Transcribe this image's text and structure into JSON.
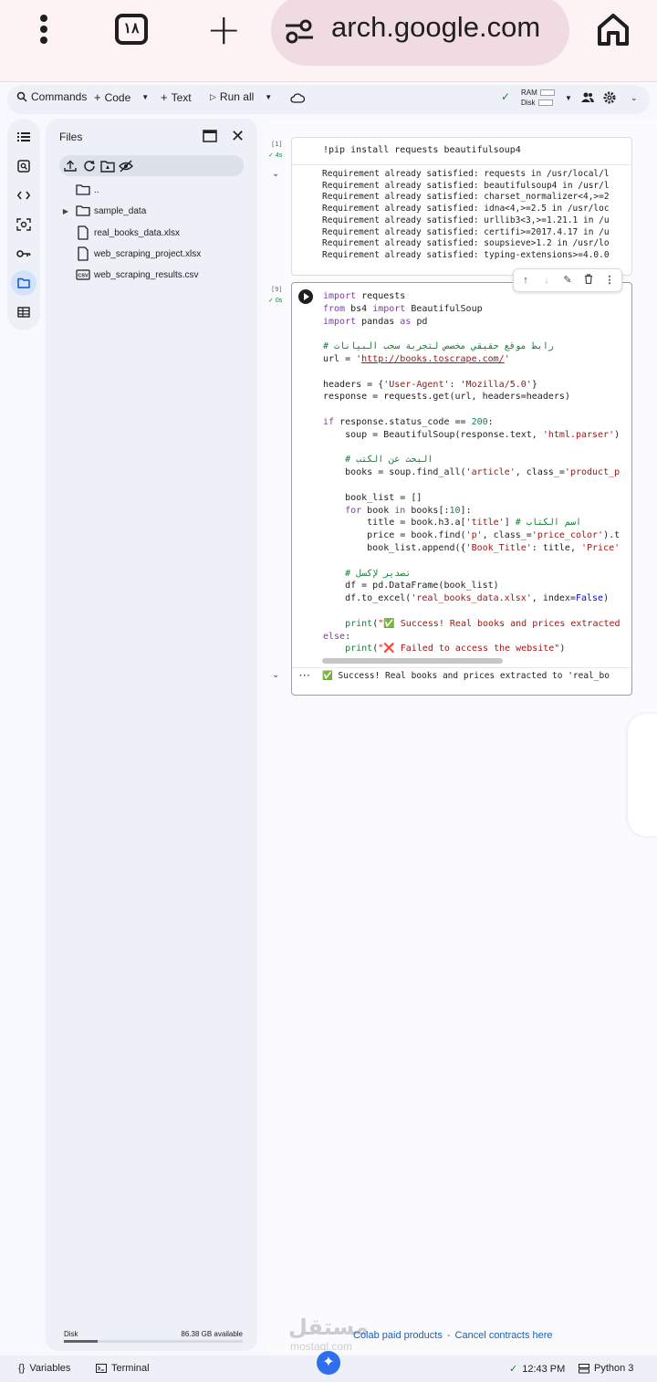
{
  "browser": {
    "tab_count": "١٨",
    "url": "arch.google.com"
  },
  "toolbar": {
    "commands": "Commands",
    "code": "Code",
    "text": "Text",
    "run_all": "Run all",
    "ram": "RAM",
    "disk": "Disk"
  },
  "files": {
    "title": "Files",
    "items": [
      {
        "name": "..",
        "type": "folder"
      },
      {
        "name": "sample_data",
        "type": "folder"
      },
      {
        "name": "real_books_data.xlsx",
        "type": "file"
      },
      {
        "name": "web_scraping_project.xlsx",
        "type": "file"
      },
      {
        "name": "web_scraping_results.csv",
        "type": "csv"
      }
    ],
    "disk_label": "Disk",
    "disk_available": "86.38 GB available",
    "disk_used_fraction": 0.19
  },
  "cell1": {
    "exec_num": "[1]",
    "duration": "4s",
    "code": "!pip install requests beautifulsoup4",
    "output": [
      "Requirement already satisfied: requests in /usr/local/l",
      "Requirement already satisfied: beautifulsoup4 in /usr/l",
      "Requirement already satisfied: charset_normalizer<4,>=2",
      "Requirement already satisfied: idna<4,>=2.5 in /usr/loc",
      "Requirement already satisfied: urllib3<3,>=1.21.1 in /u",
      "Requirement already satisfied: certifi>=2017.4.17 in /u",
      "Requirement already satisfied: soupsieve>1.2 in /usr/lo",
      "Requirement already satisfied: typing-extensions>=4.0.0"
    ]
  },
  "cell2": {
    "exec_num": "[9]",
    "duration": "0s",
    "output": "✅ Success! Real books and prices extracted to 'real_bo"
  },
  "footer": {
    "paid": "Colab paid products",
    "sep": "-",
    "cancel": "Cancel contracts here"
  },
  "watermark": {
    "ar": "مستقل",
    "lat": "mostaql.com"
  },
  "status": {
    "variables": "Variables",
    "terminal": "Terminal",
    "time": "12:43 PM",
    "kernel": "Python 3"
  }
}
